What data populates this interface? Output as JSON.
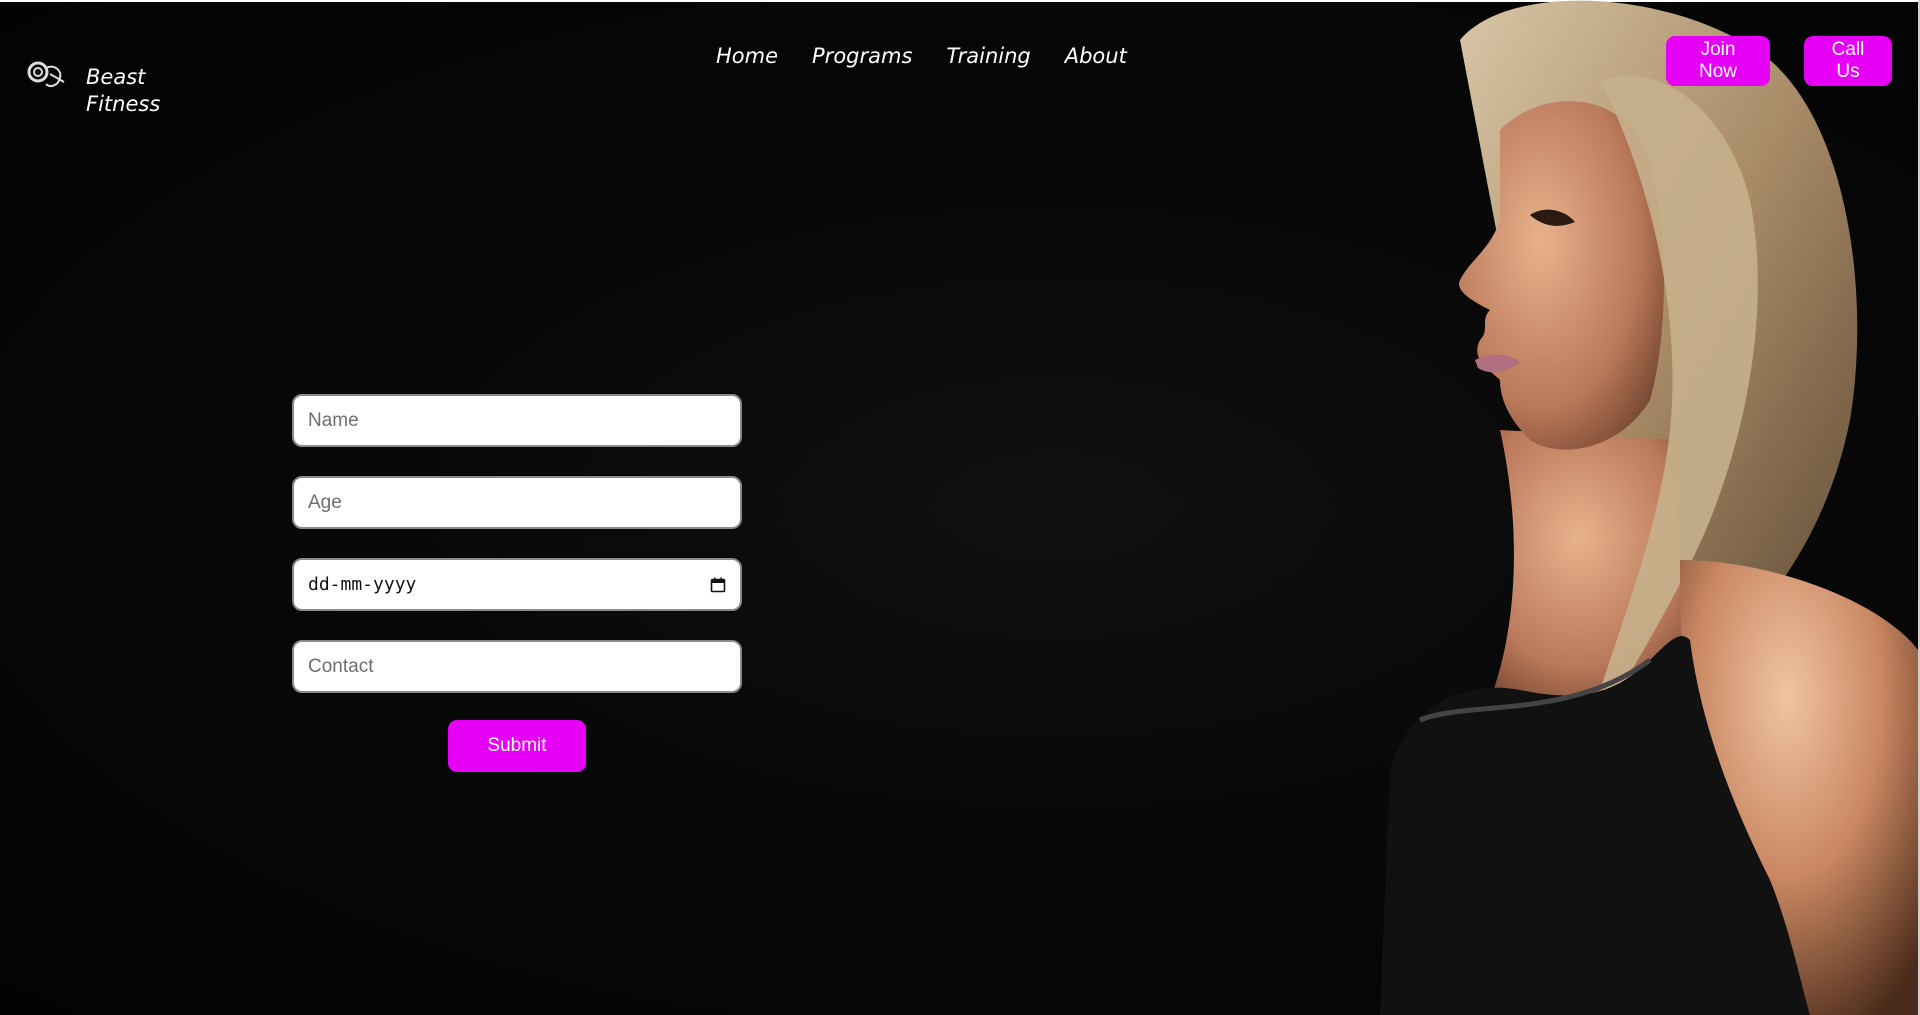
{
  "brand": {
    "logo_icon": "beast-fitness-logo",
    "name_line1": "Beast",
    "name_line2": "Fitness"
  },
  "nav": {
    "items": [
      {
        "label": "Home"
      },
      {
        "label": "Programs"
      },
      {
        "label": "Training"
      },
      {
        "label": "About"
      }
    ]
  },
  "header_buttons": {
    "join_label": "Join Now",
    "call_label": "Call Us"
  },
  "form": {
    "name_placeholder": "Name",
    "age_placeholder": "Age",
    "date_placeholder": "dd-mm-yyyy",
    "contact_placeholder": "Contact",
    "submit_label": "Submit"
  },
  "colors": {
    "accent": "#e600f5",
    "background": "#080808",
    "text": "#ffffff"
  },
  "icons": {
    "calendar": "calendar-icon"
  }
}
